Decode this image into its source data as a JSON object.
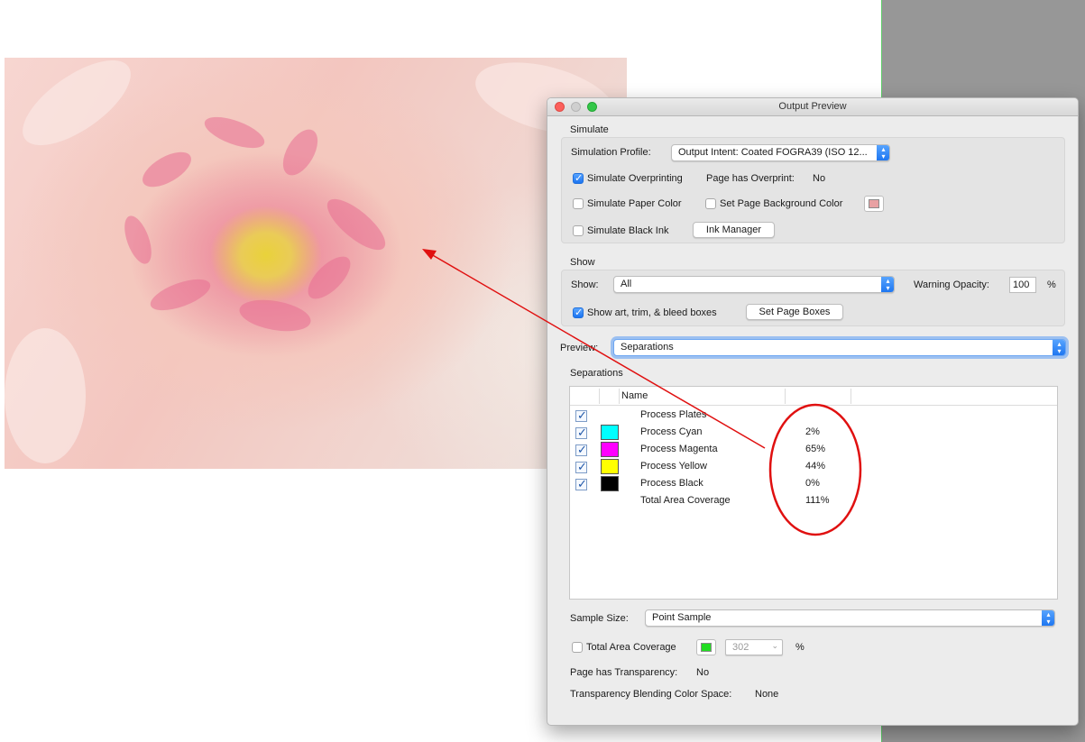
{
  "window": {
    "title": "Output Preview"
  },
  "simulate": {
    "section_label": "Simulate",
    "profile_label": "Simulation Profile:",
    "profile_value": "Output Intent: Coated FOGRA39 (ISO 12...",
    "overprint_label": "Simulate Overprinting",
    "overprint_checked": true,
    "page_overprint_label": "Page has Overprint:",
    "page_overprint_value": "No",
    "paper_color_label": "Simulate Paper Color",
    "bg_color_label": "Set Page Background Color",
    "bg_swatch_color": "#e8a1a3",
    "black_ink_label": "Simulate Black Ink",
    "ink_manager_label": "Ink Manager"
  },
  "show": {
    "section_label": "Show",
    "show_label": "Show:",
    "show_value": "All",
    "warning_opacity_label": "Warning Opacity:",
    "warning_opacity_value": "100",
    "percent": "%",
    "boxes_label": "Show art, trim, & bleed boxes",
    "boxes_checked": true,
    "set_page_boxes_label": "Set Page Boxes"
  },
  "preview": {
    "label": "Preview:",
    "value": "Separations"
  },
  "separations": {
    "section_label": "Separations",
    "name_header": "Name",
    "rows": [
      {
        "name": "Process Plates",
        "percent": "",
        "color": ""
      },
      {
        "name": "Process Cyan",
        "percent": "2%",
        "color": "#00ffff"
      },
      {
        "name": "Process Magenta",
        "percent": "65%",
        "color": "#ff00ff"
      },
      {
        "name": "Process Yellow",
        "percent": "44%",
        "color": "#ffff00"
      },
      {
        "name": "Process Black",
        "percent": "0%",
        "color": "#000000"
      }
    ],
    "total": {
      "name": "Total Area Coverage",
      "percent": "111%"
    }
  },
  "sample_size": {
    "label": "Sample Size:",
    "value": "Point Sample"
  },
  "tac": {
    "label": "Total Area Coverage",
    "swatch_color": "#22dd22",
    "value": "302",
    "percent": "%"
  },
  "transparency": {
    "label": "Page has Transparency:",
    "value": "No",
    "blend_label": "Transparency Blending Color Space:",
    "blend_value": "None"
  },
  "annotation": {
    "color": "#e01010"
  }
}
